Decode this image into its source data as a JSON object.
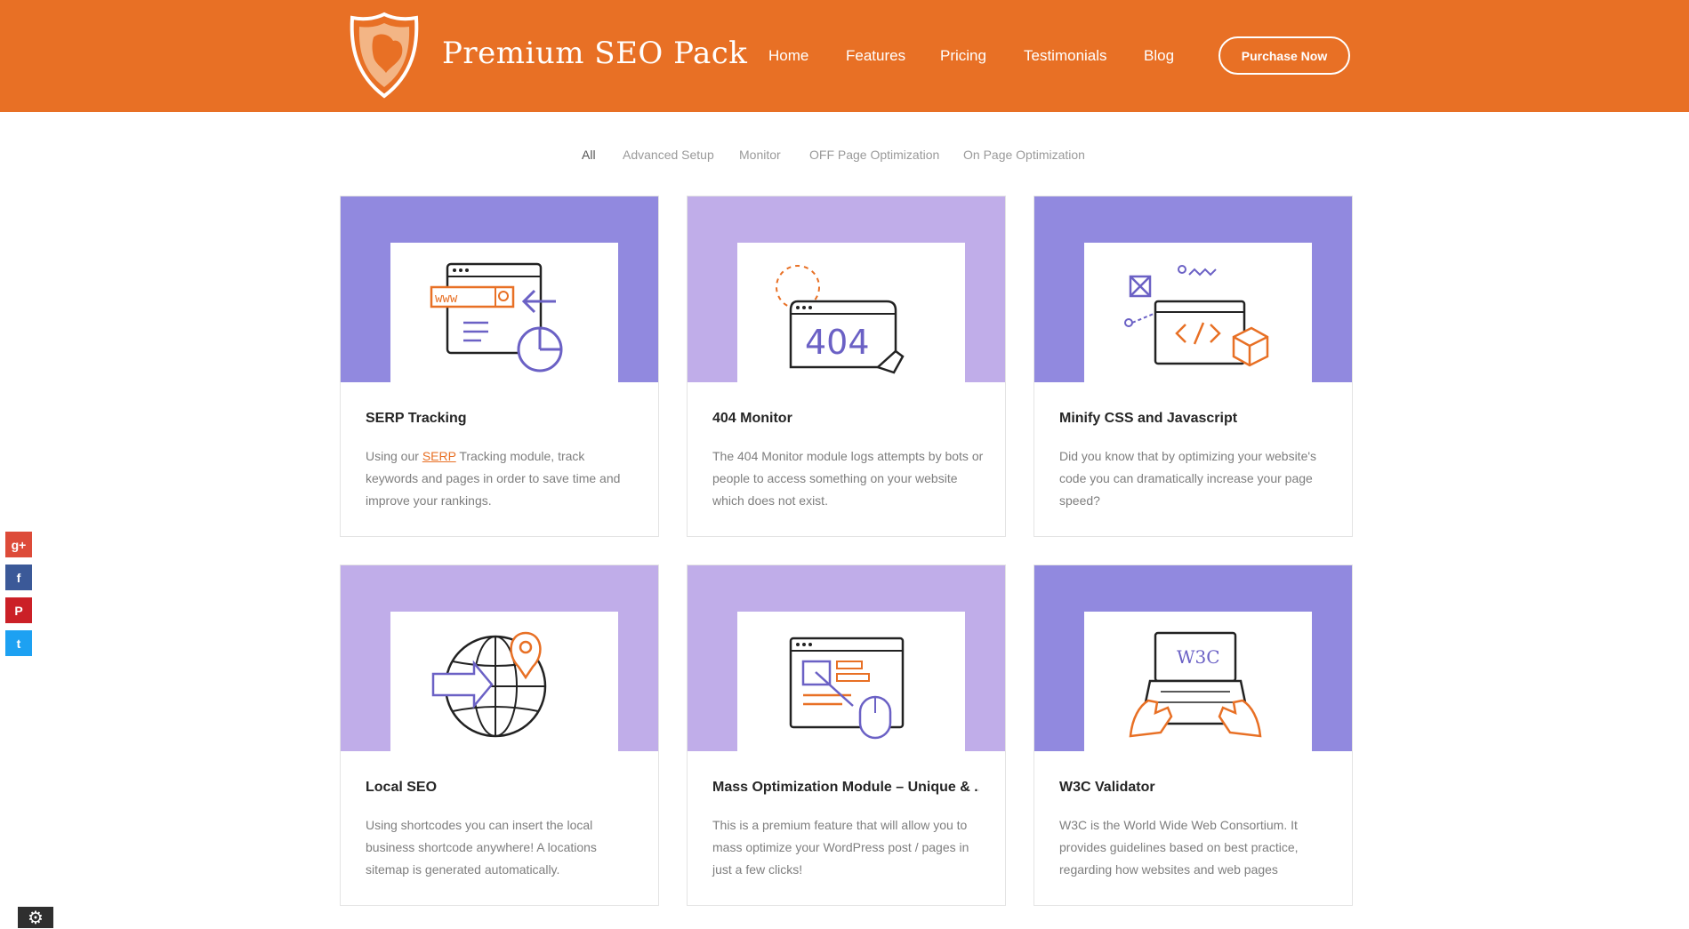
{
  "brand": {
    "title": "Premium SEO Pack",
    "accent": "#e87025"
  },
  "nav": {
    "items": [
      "Home",
      "Features",
      "Pricing",
      "Testimonials",
      "Blog"
    ],
    "purchase_label": "Purchase Now"
  },
  "filters": {
    "items": [
      "All",
      "Advanced Setup",
      "Monitor",
      "OFF Page Optimization",
      "On Page Optimization"
    ],
    "active": "All"
  },
  "cards": [
    {
      "title": "SERP Tracking",
      "desc_before": "Using our ",
      "desc_link": "SERP",
      "desc_after": " Tracking module, track keywords and pages in order to save time and improve your rankings.",
      "icon": "browser-www-search-pie-icon"
    },
    {
      "title": "404 Monitor",
      "desc": "The 404 Monitor module logs attempts by bots or people to access something on your website which does not exist.",
      "icon": "404-page-icon",
      "icon_text": "404"
    },
    {
      "title": "Minify CSS and Javascript",
      "desc": "Did you know that by optimizing your website's code you can dramatically increase your page speed?",
      "icon": "code-box-icon"
    },
    {
      "title": "Local SEO",
      "desc": "Using shortcodes you can insert the local business shortcode anywhere! A locations sitemap is generated automatically.",
      "icon": "globe-location-pin-icon"
    },
    {
      "title": "Mass Optimization Module – Unique & ...",
      "desc": "This is a premium feature that will allow you to mass optimize your WordPress post / pages in just a few clicks!",
      "icon": "browser-mouse-icon"
    },
    {
      "title": "W3C Validator",
      "desc": "W3C is the World Wide Web Consortium. It provides guidelines based on best practice, regarding how websites and web pages",
      "icon": "laptop-w3c-hands-icon",
      "icon_text": "W3C"
    }
  ],
  "social": [
    {
      "name": "google-plus-icon",
      "glyph": "g+",
      "color": "#dd4b39"
    },
    {
      "name": "facebook-icon",
      "glyph": "f",
      "color": "#3b5998"
    },
    {
      "name": "pinterest-icon",
      "glyph": "P",
      "color": "#cb2027"
    },
    {
      "name": "twitter-icon",
      "glyph": "t",
      "color": "#1da1f2"
    }
  ],
  "settings_glyph": "⚙"
}
